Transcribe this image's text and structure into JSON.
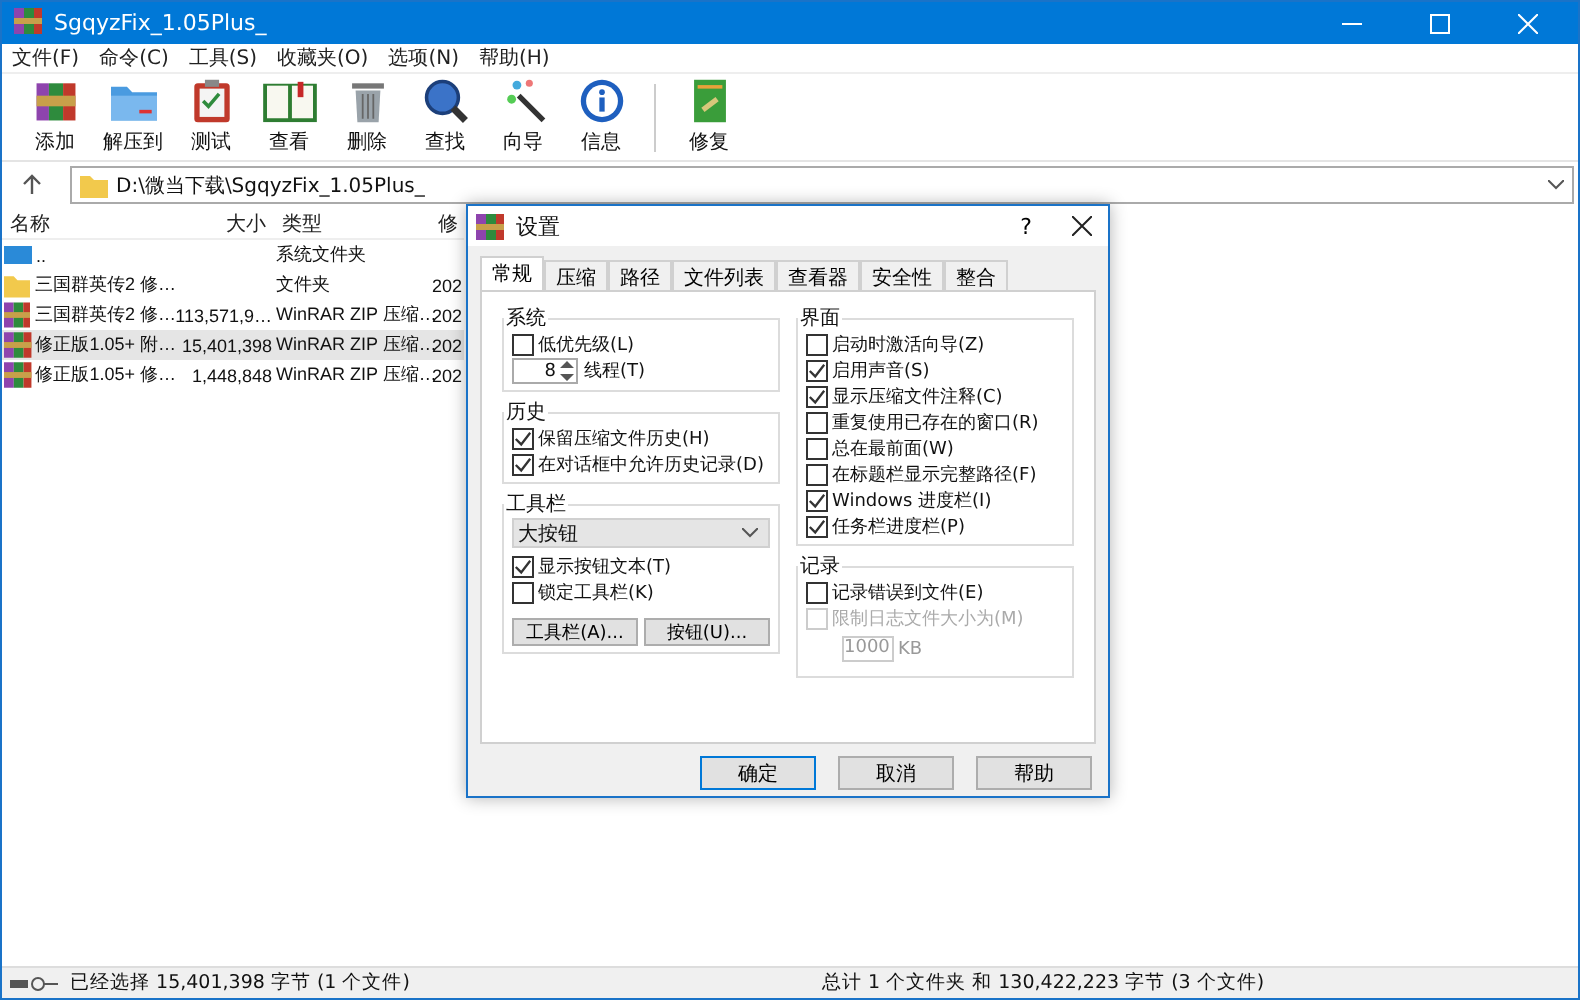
{
  "window": {
    "title": "SgqyzFix_1.05Plus_"
  },
  "menu": [
    "文件(F)",
    "命令(C)",
    "工具(S)",
    "收藏夹(O)",
    "选项(N)",
    "帮助(H)"
  ],
  "toolbar": [
    {
      "label": "添加",
      "kind": "archive"
    },
    {
      "label": "解压到",
      "kind": "folder"
    },
    {
      "label": "测试",
      "kind": "clipboard"
    },
    {
      "label": "查看",
      "kind": "book"
    },
    {
      "label": "删除",
      "kind": "trash"
    },
    {
      "label": "查找",
      "kind": "search"
    },
    {
      "label": "向导",
      "kind": "wand"
    },
    {
      "label": "信息",
      "kind": "info"
    },
    {
      "label": "修复",
      "kind": "repair"
    }
  ],
  "address": {
    "path": "D:\\微当下载\\SgqyzFix_1.05Plus_"
  },
  "columns": [
    "名称",
    "大小",
    "类型",
    "修"
  ],
  "rows": [
    {
      "kind": "drive",
      "name": "..",
      "type": "系统文件夹",
      "selected": false
    },
    {
      "kind": "folder",
      "name": "三国群英传2 修…",
      "type": "文件夹",
      "modified": "202",
      "selected": false
    },
    {
      "kind": "archive",
      "name": "三国群英传2 修…",
      "size": "113,571,9…",
      "type": "WinRAR ZIP 压缩…",
      "modified": "202",
      "selected": false
    },
    {
      "kind": "archive",
      "name": "修正版1.05+ 附…",
      "size": "15,401,398",
      "type": "WinRAR ZIP 压缩…",
      "modified": "202",
      "selected": true
    },
    {
      "kind": "archive",
      "name": "修正版1.05+ 修…",
      "size": "1,448,848",
      "type": "WinRAR ZIP 压缩…",
      "modified": "202",
      "selected": false
    }
  ],
  "dialog": {
    "title": "设置",
    "help": "?",
    "tabs": [
      {
        "label": "常规",
        "selected": true
      },
      {
        "label": "压缩",
        "selected": false
      },
      {
        "label": "路径",
        "selected": false
      },
      {
        "label": "文件列表",
        "selected": false
      },
      {
        "label": "查看器",
        "selected": false
      },
      {
        "label": "安全性",
        "selected": false
      },
      {
        "label": "整合",
        "selected": false
      }
    ],
    "system": {
      "title": "系统",
      "priority": {
        "label": "低优先级(L)",
        "checked": false
      },
      "threads": {
        "value": "8",
        "label": "线程(T)"
      }
    },
    "history": {
      "title": "历史",
      "items": [
        {
          "label": "保留压缩文件历史(H)",
          "checked": true
        },
        {
          "label": "在对话框中允许历史记录(D)",
          "checked": true
        }
      ]
    },
    "toolbar": {
      "title": "工具栏",
      "dropdown": "大按钮",
      "items": [
        {
          "label": "显示按钮文本(T)",
          "checked": true
        },
        {
          "label": "锁定工具栏(K)",
          "checked": false
        }
      ],
      "buttons": [
        "工具栏(A)...",
        "按钮(U)..."
      ]
    },
    "interface": {
      "title": "界面",
      "items": [
        {
          "label": "启动时激活向导(Z)",
          "checked": false
        },
        {
          "label": "启用声音(S)",
          "checked": true
        },
        {
          "label": "显示压缩文件注释(C)",
          "checked": true
        },
        {
          "label": "重复使用已存在的窗口(R)",
          "checked": false
        },
        {
          "label": "总在最前面(W)",
          "checked": false
        },
        {
          "label": "在标题栏显示完整路径(F)",
          "checked": false
        },
        {
          "label": "Windows 进度栏(I)",
          "checked": true
        },
        {
          "label": "任务栏进度栏(P)",
          "checked": true
        }
      ]
    },
    "log": {
      "title": "记录",
      "items": [
        {
          "label": "记录错误到文件(E)",
          "checked": false,
          "disabled": false
        },
        {
          "label": "限制日志文件大小为(M)",
          "checked": false,
          "disabled": true
        }
      ],
      "size": "1000",
      "unit": "KB",
      "disabled": true
    },
    "buttons": [
      {
        "label": "确定",
        "default": true
      },
      {
        "label": "取消",
        "default": false
      },
      {
        "label": "帮助",
        "default": false
      }
    ]
  },
  "status": {
    "left": "已经选择 15,401,398 字节 (1 个文件)",
    "right": "总计 1 个文件夹 和 130,422,223 字节 (3 个文件)"
  }
}
